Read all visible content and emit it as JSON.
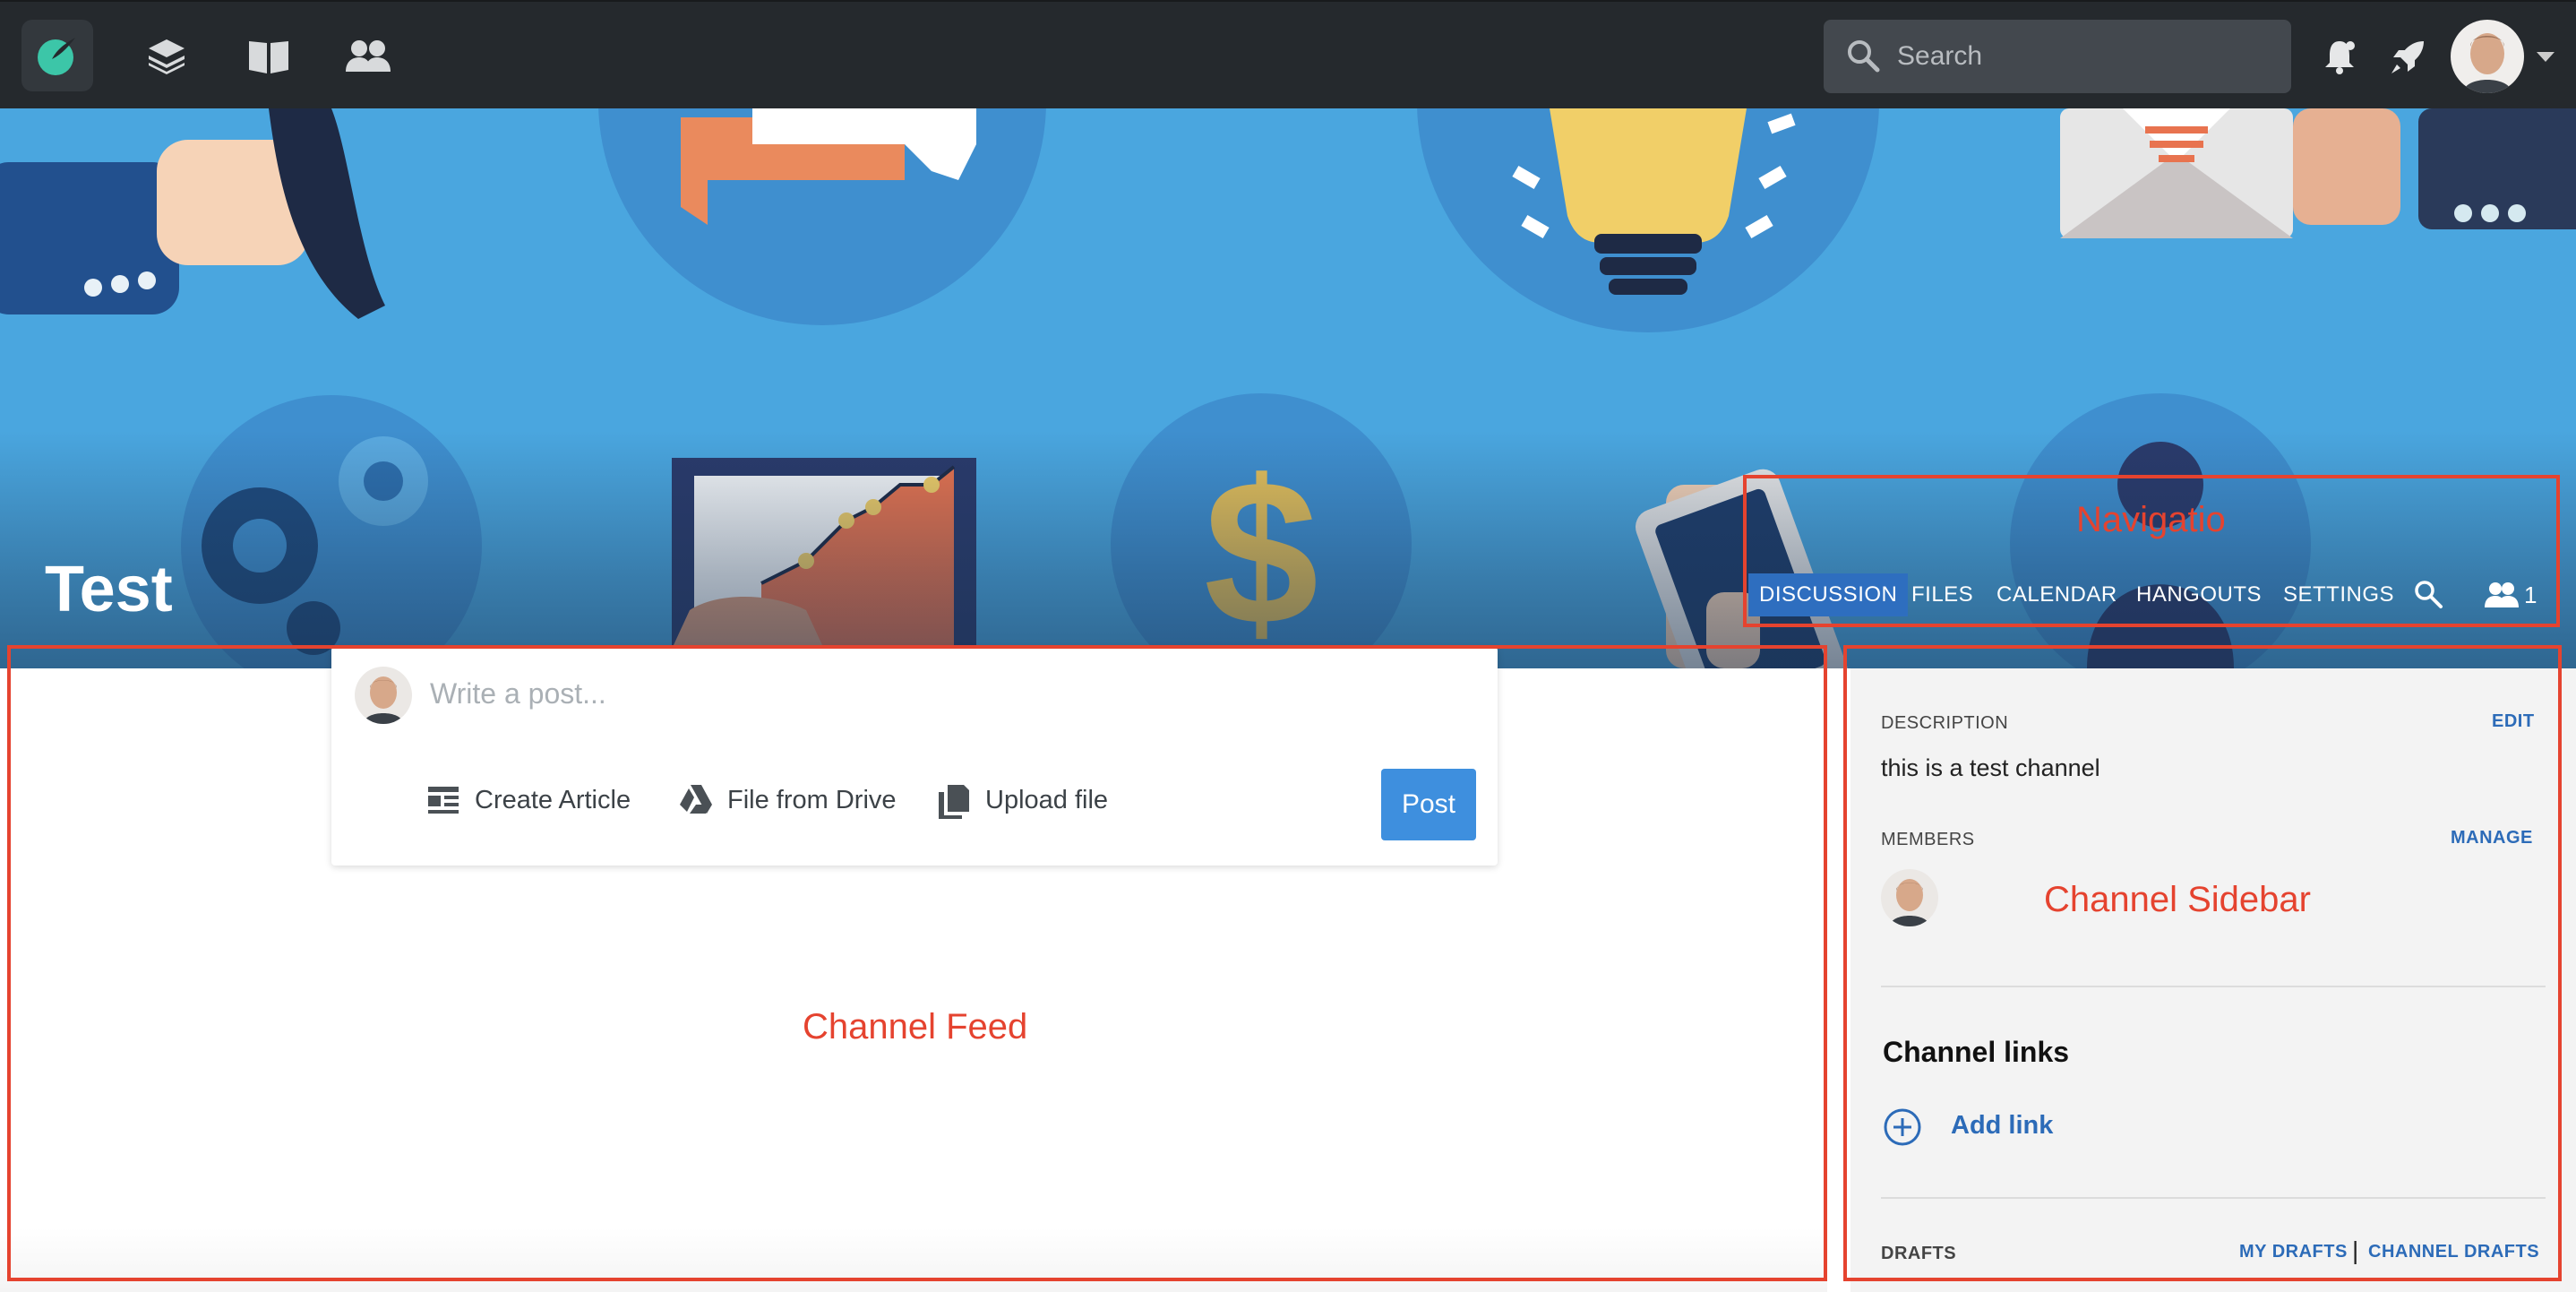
{
  "search": {
    "placeholder": "Search"
  },
  "channel": {
    "title": "Test"
  },
  "channel_nav": {
    "tabs": [
      {
        "label": "DISCUSSION",
        "active": true
      },
      {
        "label": "FILES"
      },
      {
        "label": "CALENDAR"
      },
      {
        "label": "HANGOUTS"
      },
      {
        "label": "SETTINGS"
      }
    ],
    "member_count": "1"
  },
  "composer": {
    "placeholder": "Write a post...",
    "actions": [
      "Create Article",
      "File from Drive",
      "Upload file"
    ],
    "post_label": "Post"
  },
  "sidebar": {
    "description_label": "DESCRIPTION",
    "edit_label": "EDIT",
    "description_text": "this is a test channel",
    "members_label": "MEMBERS",
    "manage_label": "MANAGE",
    "links_heading": "Channel links",
    "add_link_label": "Add link",
    "drafts_label": "DRAFTS",
    "my_drafts_label": "MY DRAFTS",
    "separator": "|",
    "channel_drafts_label": "CHANNEL DRAFTS"
  },
  "annotations": {
    "navigation": "Navigatio",
    "feed": "Channel Feed",
    "sidebar": "Channel Sidebar"
  },
  "colors": {
    "accent": "#2e6ebf",
    "post_button": "#3e8fde",
    "annotation": "#e5432f",
    "topbar": "#25292d",
    "banner": "#4aa6df"
  },
  "icons": [
    "app-logo-icon",
    "layers-icon",
    "book-icon",
    "people-icon",
    "search-icon",
    "bell-icon",
    "rocket-icon",
    "article-icon",
    "drive-icon",
    "upload-file-icon",
    "members-icon",
    "add-circle-icon"
  ]
}
